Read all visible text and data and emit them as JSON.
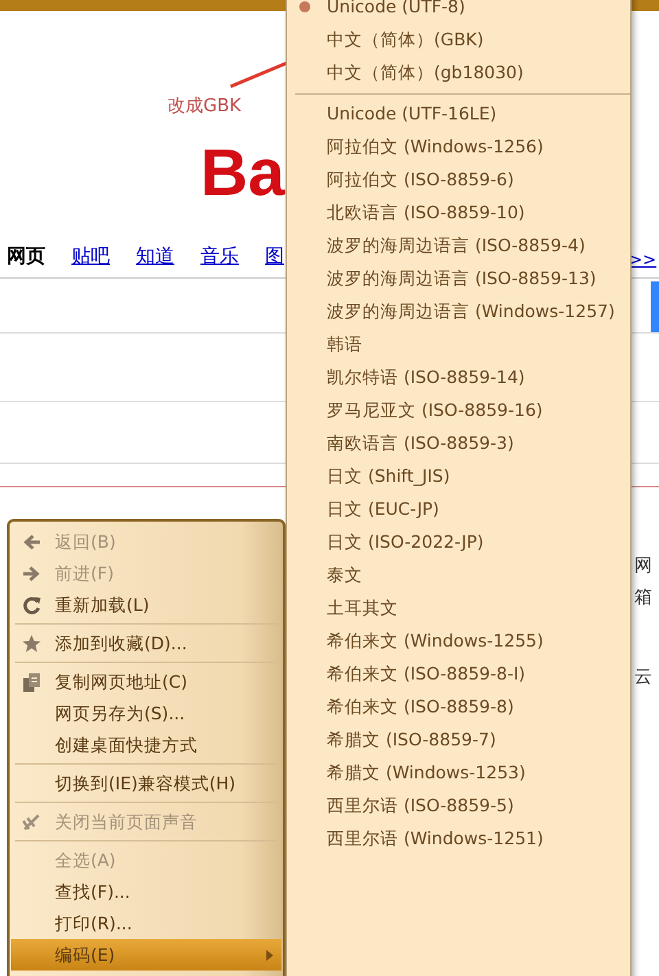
{
  "annotation": {
    "text": "改成GBK"
  },
  "page": {
    "logo": "Ba",
    "nav_tabs": [
      {
        "label": "网页",
        "selected": true
      },
      {
        "label": "贴吧",
        "selected": false
      },
      {
        "label": "知道",
        "selected": false
      },
      {
        "label": "音乐",
        "selected": false
      },
      {
        "label": "图",
        "selected": false
      }
    ],
    "more_link": ">>",
    "right_fragments": [
      "网",
      "箱",
      "云"
    ]
  },
  "context_menu": {
    "groups": [
      [
        {
          "label": "返回(B)",
          "kind": "back",
          "disabled": true,
          "selected": false
        },
        {
          "label": "前进(F)",
          "kind": "forward",
          "disabled": true,
          "selected": false
        },
        {
          "label": "重新加载(L)",
          "kind": "reload",
          "disabled": false,
          "selected": false
        }
      ],
      [
        {
          "label": "添加到收藏(D)...",
          "kind": "star",
          "disabled": false,
          "selected": false
        }
      ],
      [
        {
          "label": "复制网页地址(C)",
          "kind": "copy",
          "disabled": false,
          "selected": false
        },
        {
          "label": "网页另存为(S)...",
          "kind": "plain",
          "disabled": false,
          "selected": false
        },
        {
          "label": "创建桌面快捷方式",
          "kind": "plain",
          "disabled": false,
          "selected": false
        }
      ],
      [
        {
          "label": "切换到(IE)兼容模式(H)",
          "kind": "plain",
          "disabled": false,
          "selected": false
        }
      ],
      [
        {
          "label": "关闭当前页面声音",
          "kind": "mute",
          "disabled": true,
          "selected": false
        }
      ],
      [
        {
          "label": "全选(A)",
          "kind": "plain",
          "disabled": true,
          "selected": false
        },
        {
          "label": "查找(F)...",
          "kind": "plain",
          "disabled": false,
          "selected": false
        },
        {
          "label": "打印(R)...",
          "kind": "plain",
          "disabled": false,
          "selected": false
        },
        {
          "label": "编码(E)",
          "kind": "submenu",
          "disabled": false,
          "selected": true
        }
      ]
    ]
  },
  "encoding_menu": {
    "groups": [
      [
        {
          "label": "Unicode (UTF-8)",
          "checked": true
        },
        {
          "label": "中文（简体）(GBK)",
          "checked": false
        },
        {
          "label": "中文（简体）(gb18030)",
          "checked": false
        }
      ],
      [
        {
          "label": "Unicode (UTF-16LE)",
          "checked": false
        },
        {
          "label": "阿拉伯文 (Windows-1256)",
          "checked": false
        },
        {
          "label": "阿拉伯文 (ISO-8859-6)",
          "checked": false
        },
        {
          "label": "北欧语言 (ISO-8859-10)",
          "checked": false
        },
        {
          "label": "波罗的海周边语言 (ISO-8859-4)",
          "checked": false
        },
        {
          "label": "波罗的海周边语言 (ISO-8859-13)",
          "checked": false
        },
        {
          "label": "波罗的海周边语言 (Windows-1257)",
          "checked": false
        },
        {
          "label": "韩语",
          "checked": false
        },
        {
          "label": "凯尔特语 (ISO-8859-14)",
          "checked": false
        },
        {
          "label": "罗马尼亚文 (ISO-8859-16)",
          "checked": false
        },
        {
          "label": "南欧语言 (ISO-8859-3)",
          "checked": false
        },
        {
          "label": "日文 (Shift_JIS)",
          "checked": false
        },
        {
          "label": "日文 (EUC-JP)",
          "checked": false
        },
        {
          "label": "日文 (ISO-2022-JP)",
          "checked": false
        },
        {
          "label": "泰文",
          "checked": false
        },
        {
          "label": "土耳其文",
          "checked": false
        },
        {
          "label": "希伯来文 (Windows-1255)",
          "checked": false
        },
        {
          "label": "希伯来文 (ISO-8859-8-I)",
          "checked": false
        },
        {
          "label": "希伯来文 (ISO-8859-8)",
          "checked": false
        },
        {
          "label": "希腊文 (ISO-8859-7)",
          "checked": false
        },
        {
          "label": "希腊文 (Windows-1253)",
          "checked": false
        },
        {
          "label": "西里尔语 (ISO-8859-5)",
          "checked": false
        },
        {
          "label": "西里尔语 (Windows-1251)",
          "checked": false
        }
      ]
    ]
  }
}
